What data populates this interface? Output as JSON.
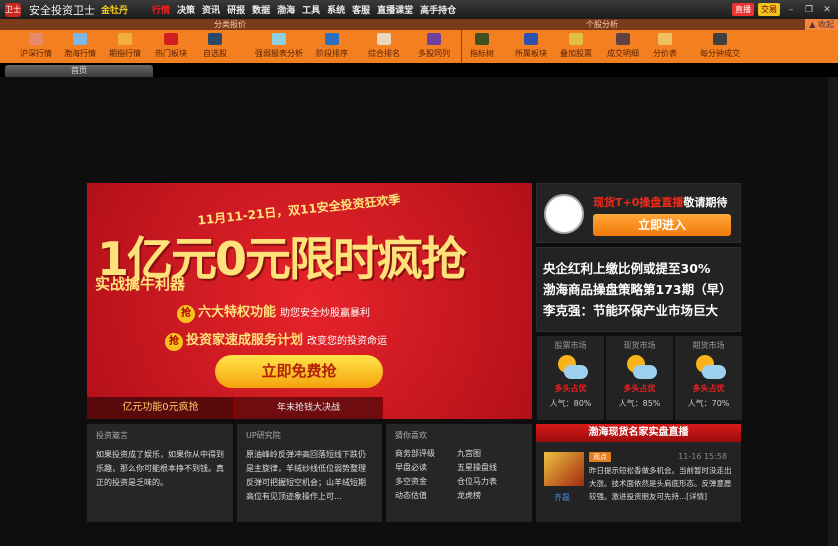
{
  "app": {
    "name": "安全投资卫士",
    "edition": "金牡丹",
    "logo_text": "卫士"
  },
  "menu": [
    "行情",
    "决策",
    "资讯",
    "研报",
    "数据",
    "渤海",
    "工具",
    "系统",
    "客服",
    "直播课堂",
    "高手持仓"
  ],
  "top_right": {
    "live": "直播",
    "trade": "交易",
    "minimize": "–",
    "restore": "❐",
    "close": "✕"
  },
  "sections": {
    "left": "分类报价",
    "right": "个股分析",
    "collapse": "▲ 收起"
  },
  "tools_left": [
    {
      "label": "沪深行情",
      "color": "#e88a6a"
    },
    {
      "label": "渤海行情",
      "color": "#7cb8e8"
    },
    {
      "label": "期指行情",
      "color": "#f0b040"
    },
    {
      "label": "热门板块",
      "color": "#d02020"
    },
    {
      "label": "自选股",
      "color": "#2a4a6a"
    },
    {
      "label": "强弱报表分析",
      "color": "#8ccfe0"
    },
    {
      "label": "阶段排序",
      "color": "#2a70c0"
    },
    {
      "label": "综合排名",
      "color": "#e8d8c0"
    },
    {
      "label": "多股同列",
      "color": "#7040a0"
    }
  ],
  "tools_right": [
    {
      "label": "指标树",
      "color": "#405020"
    },
    {
      "label": "所属板块",
      "color": "#3050b0"
    },
    {
      "label": "叠加股票",
      "color": "#e0c040"
    },
    {
      "label": "成交明细",
      "color": "#604040"
    },
    {
      "label": "分价表",
      "color": "#f0c060"
    },
    {
      "label": "每分钟成交",
      "color": "#404040"
    }
  ],
  "tab": "首页",
  "banner": {
    "top": "11月11-21日，双11安全投资狂欢季",
    "headline": "1亿元0元限时疯抢",
    "sub": "实战擒牛利器",
    "grab": "抢",
    "line1": "六大特权功能",
    "line1_note": "助您安全炒股赢暴利",
    "line2": "投资家速成服务计划",
    "line2_note": "改变您的投资命运",
    "cta": "立即免费抢",
    "tabs": [
      "亿元功能0元疯抢",
      "年末抢钱大决战"
    ]
  },
  "promo": {
    "highlight": "现货T+0操盘直播",
    "rest": "敬请期待",
    "button": "立即进入"
  },
  "news": [
    "央企红利上缴比例或提至30%",
    "渤海商品操盘策略第173期（早）",
    "李克强：节能环保产业市场巨大"
  ],
  "markets": [
    {
      "name": "股票市场",
      "status": "多头占优",
      "pop": "人气：80%"
    },
    {
      "name": "现货市场",
      "status": "多头占优",
      "pop": "人气：85%"
    },
    {
      "name": "期货市场",
      "status": "多头占优",
      "pop": "人气：70%"
    }
  ],
  "cards": {
    "quote": {
      "title": "投资箴言",
      "text": "如果投资成了娱乐，如果你从中得到乐趣，那么你可能根本挣不到钱。真正的投资是乏味的。"
    },
    "research": {
      "title": "UP研究院",
      "text": "原油峰岭反弹冲高回落短线下跌仍是主旋律，羊绒纱线低位弱势整理反弹可把握短空机会；山羊绒短期高位有见顶迹象操作上可..."
    },
    "guess": {
      "title": "猜你喜欢",
      "items": [
        "商务部评级",
        "九宫图",
        "早盘必读",
        "五星操盘线",
        "多空资金",
        "仓位马力表",
        "动态估值",
        "龙虎榜"
      ]
    }
  },
  "live": {
    "title": "渤海现货名家实盘直播",
    "name": "齐磊",
    "badge": "观点",
    "time": "11-16 15:58",
    "text": "昨日提示短松香做多机会。当前暂时没走出大涨。技术面依然是头肩底形态。反弹意愿较强。激进投资朋友可先持...[详情]"
  }
}
